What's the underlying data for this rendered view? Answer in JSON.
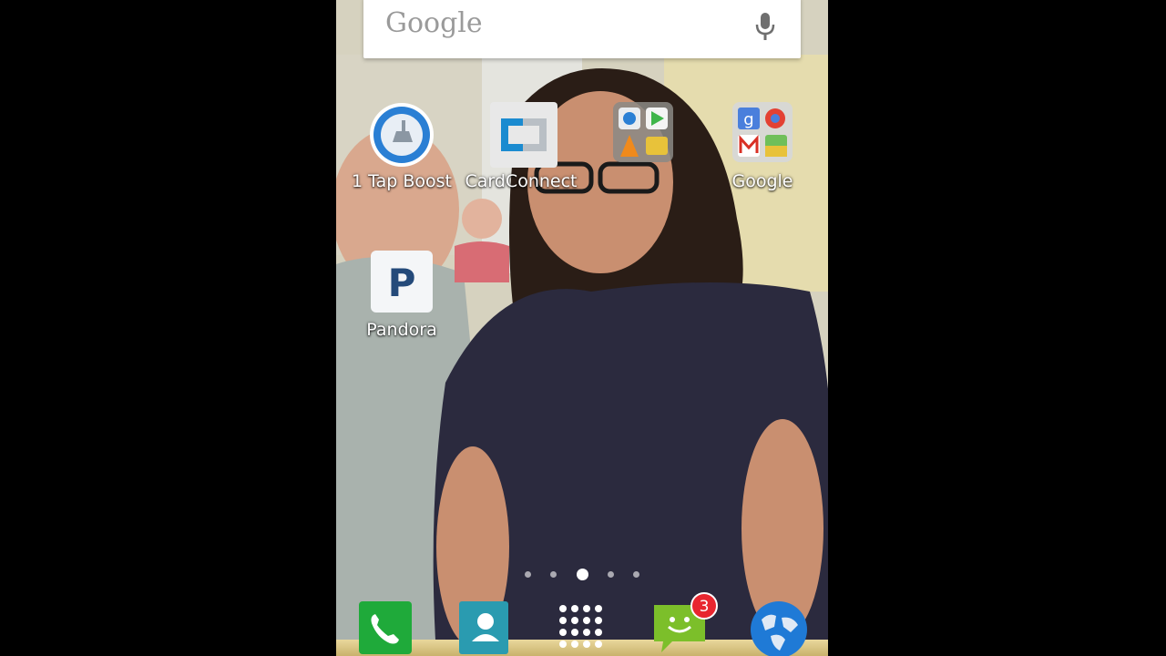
{
  "search": {
    "logo_text": "Google",
    "mic_icon": "mic-icon"
  },
  "apps": [
    {
      "label": "1 Tap Boost",
      "icon": "broom-boost-icon"
    },
    {
      "label": "CardConnect",
      "icon": "cardconnect-icon"
    },
    {
      "label": "",
      "icon": "folder-icon"
    },
    {
      "label": "Google",
      "icon": "google-folder-icon"
    },
    {
      "label": "Pandora",
      "icon": "pandora-icon"
    }
  ],
  "page_indicator": {
    "pages": 5,
    "active_index": 2
  },
  "dock": {
    "items": [
      {
        "name": "phone",
        "icon": "phone-icon"
      },
      {
        "name": "contacts",
        "icon": "contacts-icon"
      },
      {
        "name": "app-drawer",
        "icon": "app-drawer-icon"
      },
      {
        "name": "messaging",
        "icon": "messaging-icon",
        "badge": "3"
      },
      {
        "name": "browser",
        "icon": "globe-icon"
      }
    ]
  },
  "colors": {
    "badge": "#e8262f",
    "phone_green": "#1faa3a",
    "contacts_teal": "#2a9bb0",
    "boost_blue": "#2a7fd4"
  }
}
